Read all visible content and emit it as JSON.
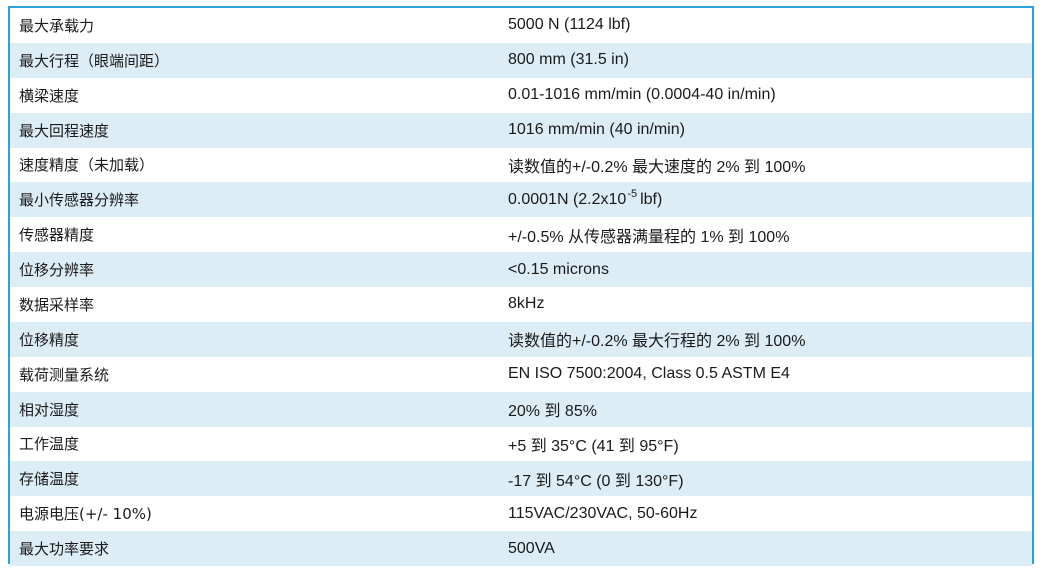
{
  "specs": [
    {
      "label": "最大承载力",
      "value": "5000 N (1124 lbf)"
    },
    {
      "label": "最大行程（眼端间距）",
      "value": "800 mm (31.5 in)"
    },
    {
      "label": "横梁速度",
      "value": "0.01-1016 mm/min (0.0004-40 in/min)"
    },
    {
      "label": "最大回程速度",
      "value": "1016 mm/min (40 in/min)"
    },
    {
      "label": "速度精度（未加载）",
      "value": "读数值的+/-0.2% 最大速度的 2% 到 100%"
    },
    {
      "label": "最小传感器分辨率",
      "value": "0.0001N (2.2x10",
      "value_sup": "-5",
      "value_suffix": "lbf)"
    },
    {
      "label": "传感器精度",
      "value": "+/-0.5%  从传感器满量程的 1% 到 100%"
    },
    {
      "label": "位移分辨率",
      "value": "<0.15 microns"
    },
    {
      "label": "数据采样率",
      "value": "8kHz"
    },
    {
      "label": "位移精度",
      "value": "读数值的+/-0.2%  最大行程的 2%  到 100%"
    },
    {
      "label": "载荷测量系统",
      "value": "EN ISO 7500:2004, Class 0.5 ASTM E4"
    },
    {
      "label": "相对湿度",
      "value": "20% 到 85%"
    },
    {
      "label": "工作温度",
      "value": "+5 到 35°C (41 到 95°F)"
    },
    {
      "label": "存储温度",
      "value": "-17 到 54°C (0 到 130°F)"
    },
    {
      "label": "电源电压(+/- 10%)",
      "value": "115VAC/230VAC, 50-60Hz"
    },
    {
      "label": "最大功率要求",
      "value": "500VA"
    }
  ]
}
